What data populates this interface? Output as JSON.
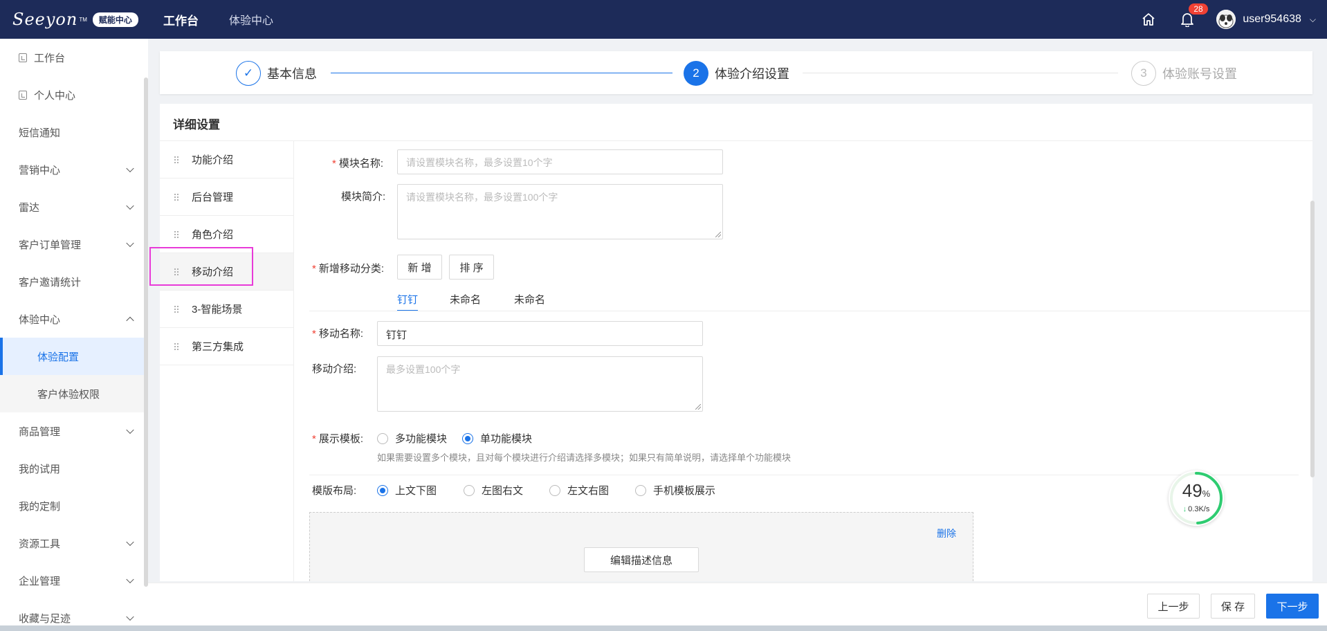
{
  "topbar": {
    "logo_text": "Seeyon",
    "logo_tm": "TM",
    "logo_badge": "赋能中心",
    "nav": [
      "工作台",
      "体验中心"
    ],
    "notification_count": "28",
    "username": "user954638"
  },
  "sidebar": {
    "items": [
      {
        "label": "工作台"
      },
      {
        "label": "个人中心"
      },
      {
        "label": "短信通知"
      },
      {
        "label": "营销中心"
      },
      {
        "label": "雷达"
      },
      {
        "label": "客户订单管理"
      },
      {
        "label": "客户邀请统计"
      },
      {
        "label": "体验中心"
      },
      {
        "label": "体验配置"
      },
      {
        "label": "客户体验权限"
      },
      {
        "label": "商品管理"
      },
      {
        "label": "我的试用"
      },
      {
        "label": "我的定制"
      },
      {
        "label": "资源工具"
      },
      {
        "label": "企业管理"
      },
      {
        "label": "收藏与足迹"
      }
    ]
  },
  "steps": [
    {
      "number": "✓",
      "label": "基本信息",
      "state": "done"
    },
    {
      "number": "2",
      "label": "体验介绍设置",
      "state": "active"
    },
    {
      "number": "3",
      "label": "体验账号设置",
      "state": "wait"
    }
  ],
  "panel": {
    "title": "详细设置",
    "modules": [
      "功能介绍",
      "后台管理",
      "角色介绍",
      "移动介绍",
      "3-智能场景",
      "第三方集成"
    ]
  },
  "form": {
    "module_name_label": "模块名称",
    "module_name_placeholder": "请设置模块名称，最多设置10个字",
    "module_intro_label": "模块简介",
    "module_intro_placeholder": "请设置模块名称，最多设置100个字",
    "add_category_label": "新增移动分类",
    "add_button": "新 增",
    "sort_button": "排 序",
    "tabs": [
      "钉钉",
      "未命名",
      "未命名"
    ],
    "mobile_name_label": "移动名称",
    "mobile_name_value": "钉钉",
    "mobile_intro_label": "移动介绍",
    "mobile_intro_placeholder": "最多设置100个字",
    "template_label": "展示模板",
    "template_options": [
      "多功能模块",
      "单功能模块"
    ],
    "template_hint": "如果需要设置多个模块，且对每个模块进行介绍请选择多模块；如果只有简单说明，请选择单个功能模块",
    "layout_label": "模版布局",
    "layout_options": [
      "上文下图",
      "左图右文",
      "左文右图",
      "手机模板展示"
    ],
    "delete_link": "删除",
    "edit_desc_button": "编辑描述信息"
  },
  "footer": {
    "prev": "上一步",
    "save": "保 存",
    "next": "下一步"
  },
  "netmon": {
    "percent": "49",
    "percent_sign": "%",
    "speed": "0.3K/s",
    "percent_value": 49
  },
  "colors": {
    "topbar": "#1d2b59",
    "accent": "#1a73e8",
    "required": "#f04134",
    "highlight": "#e83ad8"
  }
}
